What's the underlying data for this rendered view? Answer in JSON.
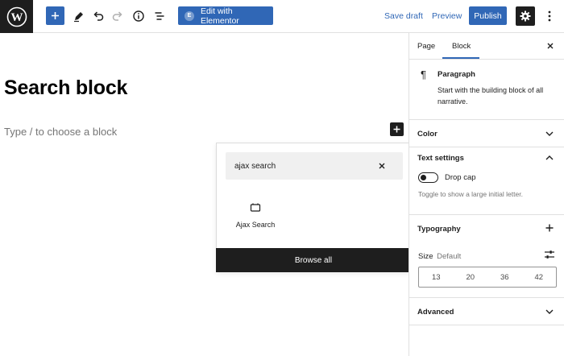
{
  "topbar": {
    "wp_logo": "wordpress-logo",
    "elementor_label": "Edit with Elementor",
    "save_draft": "Save draft",
    "preview": "Preview",
    "publish": "Publish"
  },
  "canvas": {
    "title": "Search block",
    "placeholder": "Type / to choose a block"
  },
  "inserter": {
    "search_value": "ajax search",
    "results": [
      {
        "label": "Ajax Search",
        "icon": "search-block-icon"
      }
    ],
    "browse_all": "Browse all"
  },
  "sidebar": {
    "tabs": {
      "page": "Page",
      "block": "Block"
    },
    "block_card": {
      "title": "Paragraph",
      "description": "Start with the building block of all narrative."
    },
    "color_panel": "Color",
    "text_settings": {
      "title": "Text settings",
      "drop_cap": "Drop cap",
      "help": "Toggle to show a large initial letter."
    },
    "typography": {
      "title": "Typography",
      "size_label": "Size",
      "size_default": "Default",
      "sizes": [
        "13",
        "20",
        "36",
        "42"
      ]
    },
    "advanced": "Advanced"
  },
  "colors": {
    "accent": "#3067b6",
    "dark": "#1e1e1e"
  }
}
